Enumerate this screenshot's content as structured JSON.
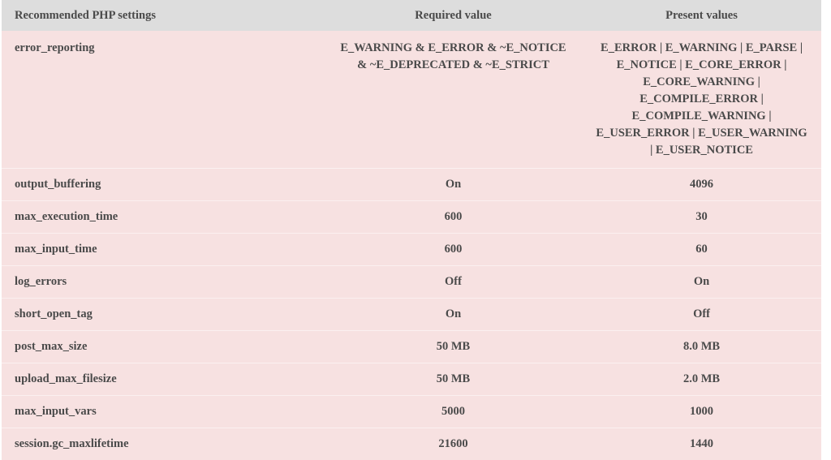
{
  "table": {
    "name": "recommended-php-settings",
    "colors": {
      "header_background": "#dddddd",
      "body_background": "#f7e1e1",
      "row_separator": "#fbf0f0",
      "text": "#4a4a4a",
      "page_background": "#ffffff"
    },
    "headers": [
      "Recommended PHP settings",
      "Required value",
      "Present values"
    ],
    "rows": [
      {
        "setting": "error_reporting",
        "required": "E_WARNING & E_ERROR & ~E_NOTICE & ~E_DEPRECATED & ~E_STRICT",
        "present": "E_ERROR | E_WARNING | E_PARSE | E_NOTICE | E_CORE_ERROR | E_CORE_WARNING | E_COMPILE_ERROR | E_COMPILE_WARNING | E_USER_ERROR | E_USER_WARNING | E_USER_NOTICE"
      },
      {
        "setting": "output_buffering",
        "required": "On",
        "present": "4096"
      },
      {
        "setting": "max_execution_time",
        "required": "600",
        "present": "30"
      },
      {
        "setting": "max_input_time",
        "required": "600",
        "present": "60"
      },
      {
        "setting": "log_errors",
        "required": "Off",
        "present": "On"
      },
      {
        "setting": "short_open_tag",
        "required": "On",
        "present": "Off"
      },
      {
        "setting": "post_max_size",
        "required": "50 MB",
        "present": "8.0 MB"
      },
      {
        "setting": "upload_max_filesize",
        "required": "50 MB",
        "present": "2.0 MB"
      },
      {
        "setting": "max_input_vars",
        "required": "5000",
        "present": "1000"
      },
      {
        "setting": "session.gc_maxlifetime",
        "required": "21600",
        "present": "1440"
      }
    ]
  }
}
